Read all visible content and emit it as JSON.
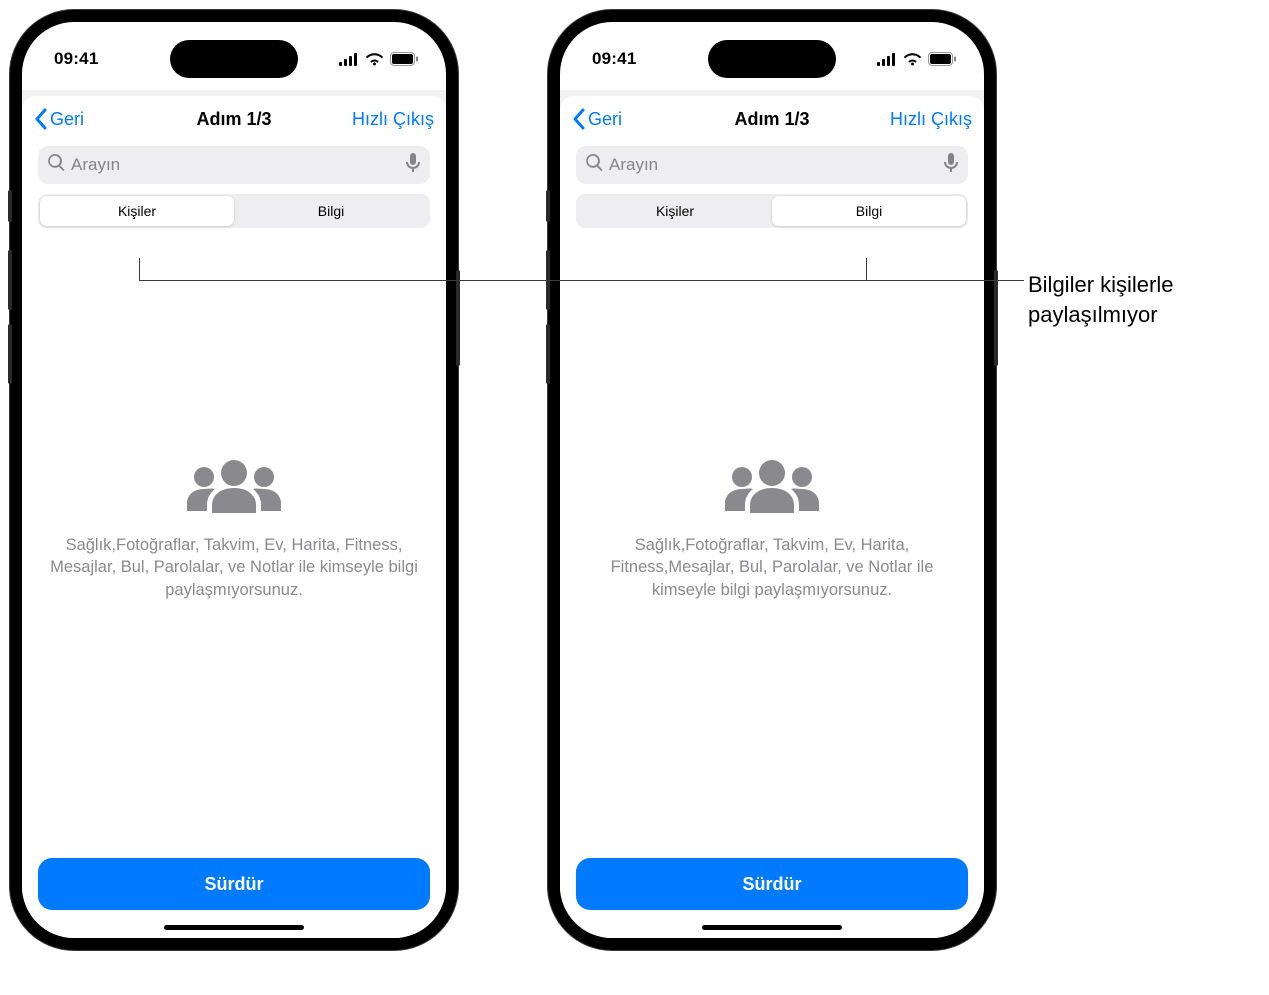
{
  "callout": "Bilgiler kişilerle paylaşılmıyor",
  "phones": [
    {
      "status": {
        "time": "09:41"
      },
      "nav": {
        "back": "Geri",
        "title": "Adım 1/3",
        "quick_exit": "Hızlı Çıkış"
      },
      "search": {
        "placeholder": "Arayın"
      },
      "segments": {
        "people": "Kişiler",
        "info": "Bilgi",
        "active": "people"
      },
      "empty_text": "Sağlık,Fotoğraflar, Takvim, Ev, Harita, Fitness, Mesajlar, Bul, Parolalar, ve Notlar ile kimseyle bilgi paylaşmıyorsunuz.",
      "continue": "Sürdür"
    },
    {
      "status": {
        "time": "09:41"
      },
      "nav": {
        "back": "Geri",
        "title": "Adım 1/3",
        "quick_exit": "Hızlı Çıkış"
      },
      "search": {
        "placeholder": "Arayın"
      },
      "segments": {
        "people": "Kişiler",
        "info": "Bilgi",
        "active": "info"
      },
      "empty_text": "Sağlık,Fotoğraflar, Takvim, Ev, Harita, Fitness,Mesajlar, Bul, Parolalar, ve Notlar ile kimseyle bilgi paylaşmıyorsunuz.",
      "continue": "Sürdür"
    }
  ]
}
